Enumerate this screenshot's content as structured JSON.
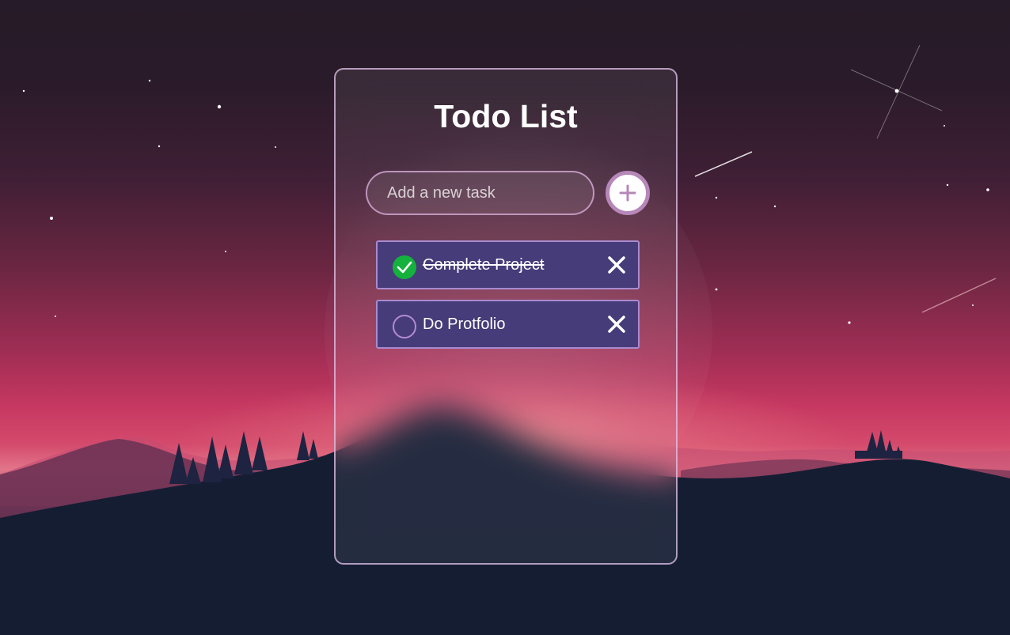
{
  "app": {
    "title": "Todo List"
  },
  "input": {
    "placeholder": "Add a new task",
    "value": ""
  },
  "add_button": {
    "icon": "plus-icon",
    "color": "#b687b8"
  },
  "todos": [
    {
      "text": "Complete Project",
      "completed": true
    },
    {
      "text": "Do Protfolio",
      "completed": false
    }
  ],
  "colors": {
    "item_background": "#463c79",
    "item_border": "#a98bcf",
    "check_done": "#15b13d",
    "check_open_border": "#b38bd1",
    "card_border": "#e0c4e8"
  },
  "icons": {
    "check": "check-icon",
    "delete": "close-icon"
  }
}
